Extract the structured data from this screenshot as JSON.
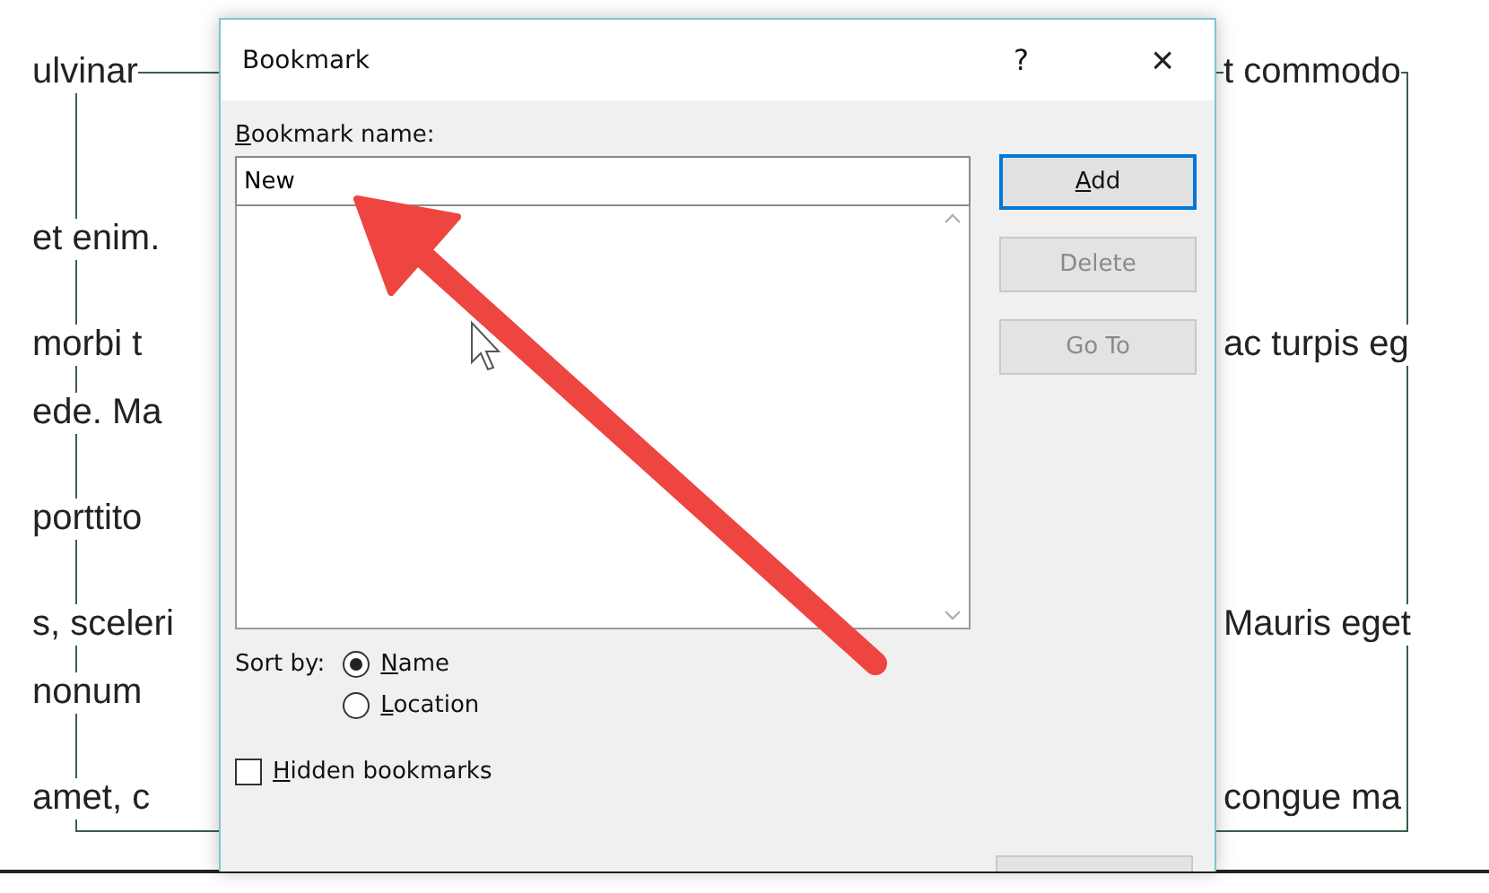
{
  "document": {
    "paragraphs": [
      {
        "lines": [
          {
            "left": "ulvinar",
            "right": "t commodo"
          }
        ]
      },
      {
        "lines": [
          {
            "left": "et enim."
          }
        ]
      },
      {
        "lines": [
          {
            "left": "morbi t",
            "right": "ac turpis eg"
          },
          {
            "left": "ede. Ma"
          }
        ]
      },
      {
        "lines": [
          {
            "left": "porttito"
          }
        ]
      },
      {
        "lines": [
          {
            "left": "s, sceleri",
            "right": "Mauris eget"
          },
          {
            "left": "nonum"
          }
        ]
      },
      {
        "lines": [
          {
            "left": "amet, c",
            "right": "congue ma"
          }
        ]
      }
    ]
  },
  "dialog": {
    "title": "Bookmark",
    "help": "?",
    "close": "×",
    "name_field": {
      "label": "Bookmark name:",
      "access_key": true,
      "value": "New"
    },
    "buttons": [
      {
        "label": "Add",
        "access_key": true,
        "disabled": false,
        "focused": true
      },
      {
        "label": "Delete",
        "access_key": false,
        "disabled": true,
        "focused": false
      },
      {
        "label": "Go To",
        "access_key": false,
        "disabled": true,
        "focused": false
      }
    ],
    "sort_by": {
      "label": "Sort by:",
      "options": [
        {
          "label": "Name",
          "access_key": true,
          "selected": true
        },
        {
          "label": "Location",
          "access_key": true,
          "selected": false
        }
      ]
    },
    "hidden_bookmarks": {
      "label": "Hidden bookmarks",
      "access_key": true,
      "checked": false
    }
  }
}
